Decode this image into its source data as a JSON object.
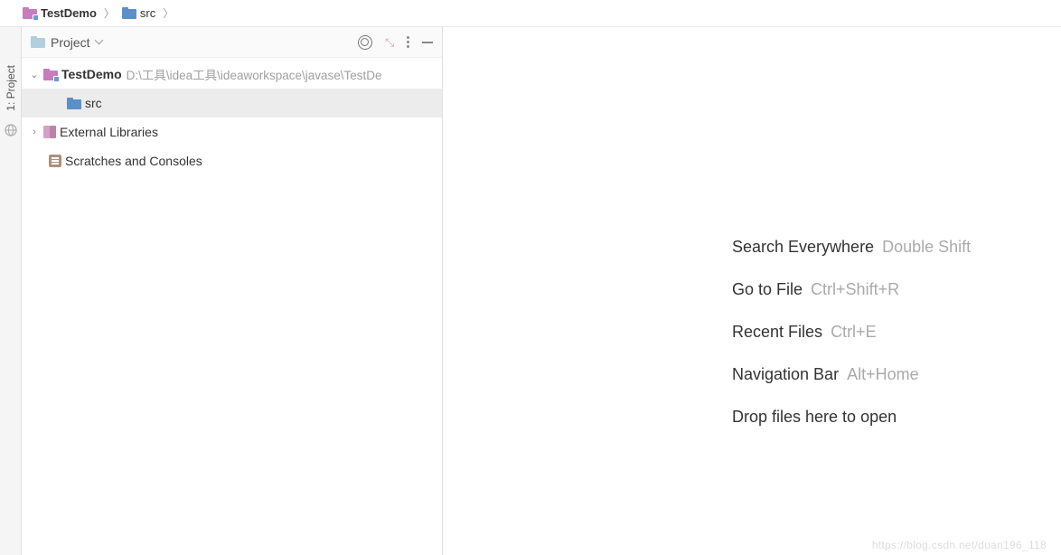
{
  "breadcrumb": {
    "items": [
      {
        "label": "TestDemo"
      },
      {
        "label": "src"
      }
    ]
  },
  "sidebar": {
    "tab_label": "1: Project"
  },
  "panel": {
    "title": "Project"
  },
  "tree": {
    "root": {
      "label": "TestDemo",
      "path": "D:\\工具\\idea工具\\ideaworkspace\\javase\\TestDe"
    },
    "src": {
      "label": "src"
    },
    "ext_libs": {
      "label": "External Libraries"
    },
    "scratches": {
      "label": "Scratches and Consoles"
    }
  },
  "editor": {
    "hints": [
      {
        "label": "Search Everywhere",
        "shortcut": "Double Shift"
      },
      {
        "label": "Go to File",
        "shortcut": "Ctrl+Shift+R"
      },
      {
        "label": "Recent Files",
        "shortcut": "Ctrl+E"
      },
      {
        "label": "Navigation Bar",
        "shortcut": "Alt+Home"
      },
      {
        "label": "Drop files here to open",
        "shortcut": ""
      }
    ]
  },
  "watermark": "https://blog.csdn.net/duan196_118"
}
